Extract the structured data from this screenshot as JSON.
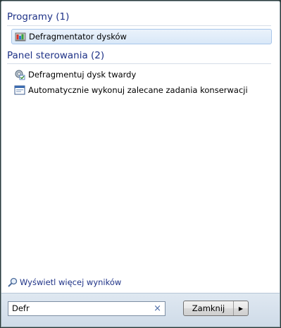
{
  "groups": [
    {
      "header": "Programy (1)",
      "items": [
        {
          "label": "Defragmentator dysków",
          "icon": "defragmenter-icon",
          "selected": true
        }
      ]
    },
    {
      "header": "Panel sterowania (2)",
      "items": [
        {
          "label": "Defragmentuj dysk twardy",
          "icon": "gear-check-icon"
        },
        {
          "label": "Automatycznie wykonuj zalecane zadania konserwacji",
          "icon": "maintenance-window-icon"
        }
      ]
    }
  ],
  "more_results": {
    "label": "Wyświetl więcej wyników",
    "icon": "search-icon"
  },
  "search": {
    "value": "Defr",
    "clear_icon": "clear-x-icon"
  },
  "shutdown_button": {
    "label": "Zamknij",
    "arrow_icon": "arrow-right-icon"
  },
  "colors": {
    "accent": "#1e3287",
    "selection": "#d9e8f8"
  }
}
